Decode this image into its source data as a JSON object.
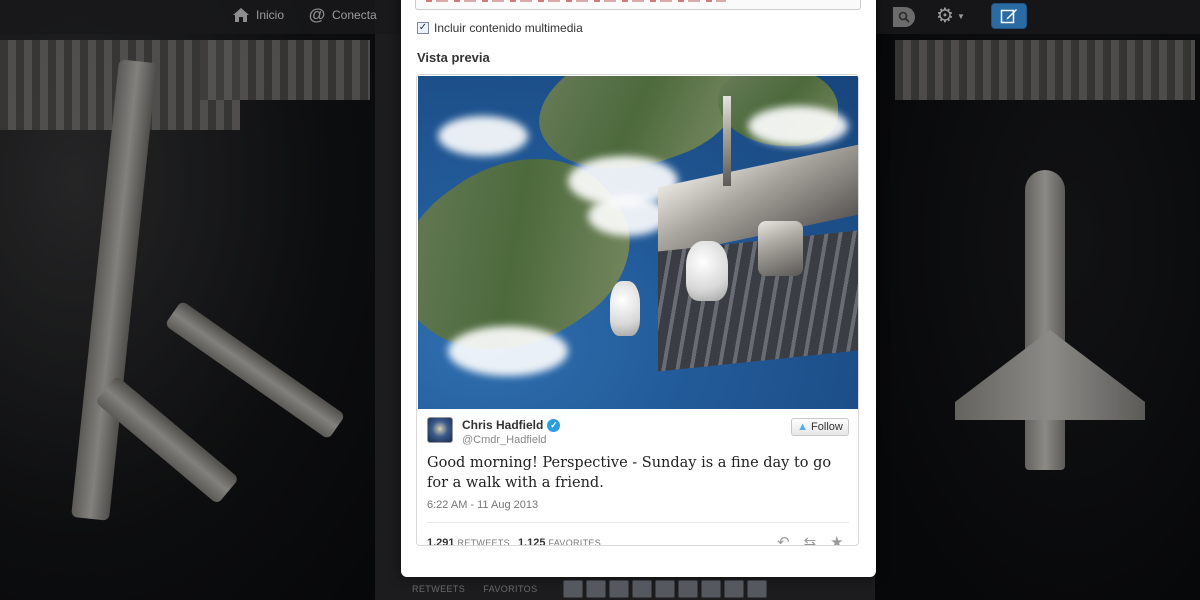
{
  "nav": {
    "home_label": "Inicio",
    "connect_label": "Conecta"
  },
  "dialog": {
    "include_media_label": "Incluir contenido multimedia",
    "include_media_checked": true,
    "preview_heading": "Vista previa"
  },
  "tweet": {
    "name": "Chris Hadfield",
    "handle": "@Cmdr_Hadfield",
    "follow_label": "Follow",
    "text": "Good morning! Perspective - Sunday is a fine day to go for a walk with a friend.",
    "timestamp": "6:22 AM - 11 Aug 2013",
    "retweets_count": "1,291",
    "retweets_label": "RETWEETS",
    "favorites_count": "1,125",
    "favorites_label": "FAVORITES"
  },
  "bottom": {
    "retweets_tab": "RETWEETS",
    "favorites_tab": "FAVORITOS"
  },
  "colors": {
    "accent": "#2b6ba3",
    "verified": "#2b9de0",
    "follow_bird": "#55acee"
  }
}
